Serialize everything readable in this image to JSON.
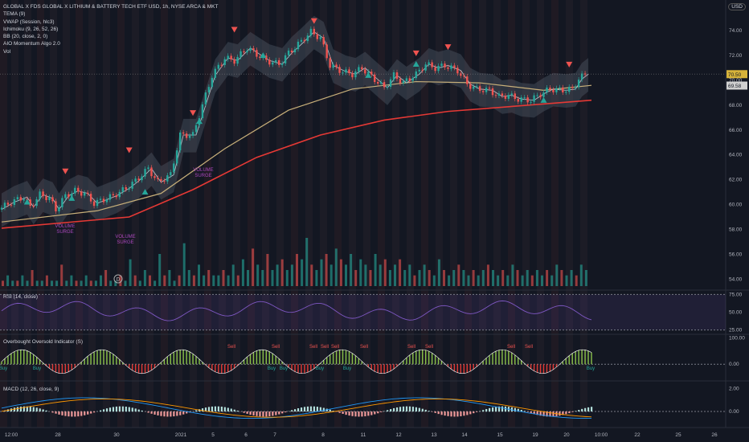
{
  "legend": {
    "symbol": "GLOBAL X FDS GLOBAL X LITHIUM & BATTERY TECH ETF USD, 1h, NYSE ARCA & MKT",
    "indicators": [
      "TEMA (9)",
      "VWAP (Session, hlc3)",
      "Ichimoku (9, 26, 52, 26)",
      "BB (20, close, 2, 0)",
      "AIO Momentum Algo 2.0",
      "Vol"
    ]
  },
  "currency": "USD",
  "panes": {
    "rsi": "RSI (14, close)",
    "obos": "Overbought Oversold Indicator (S)",
    "macd": "MACD (12, 26, close, 9)"
  },
  "signals": {
    "buy": "Buy",
    "sell": "Sell",
    "surge": [
      "VOLUME",
      "SURGE"
    ],
    "dividend": "D"
  },
  "price_badges": {
    "last": "70.50",
    "other": "69.58"
  },
  "colors": {
    "up": "#26a69a",
    "down": "#ef5350",
    "ema_red": "#e53935",
    "tan": "#c8b07a",
    "accent": "#d7b33a",
    "rsi": "#7e57c2",
    "buy": "#26a69a",
    "sell": "#ef5350"
  },
  "chart_data": [
    {
      "type": "candlestick",
      "title": "GLOBAL X FDS GLOBAL X LITHIUM & BATTERY TECH ETF USD, 1h, NYSE ARCA & MKT",
      "x_tick_labels": [
        "12:00",
        "28",
        "30",
        "2021",
        "5",
        "6",
        "7",
        "8",
        "11",
        "12",
        "13",
        "14",
        "15",
        "19",
        "20",
        "10:00",
        "22",
        "25",
        "26"
      ],
      "y_ticks": [
        "74.00",
        "72.00",
        "70.00",
        "68.00",
        "66.00",
        "64.00",
        "62.00",
        "60.00",
        "58.00",
        "56.00",
        "54.00"
      ],
      "ylim": [
        53.5,
        75.5
      ],
      "close_path": [
        [
          0,
          59.6
        ],
        [
          4,
          60.2
        ],
        [
          8,
          60.6
        ],
        [
          10,
          59.8
        ],
        [
          13,
          60.8
        ],
        [
          16,
          60.5
        ],
        [
          18,
          59.6
        ],
        [
          21,
          60.7
        ],
        [
          24,
          61.1
        ],
        [
          27,
          60.9
        ],
        [
          30,
          60.1
        ],
        [
          33,
          60.4
        ],
        [
          36,
          60.7
        ],
        [
          40,
          61.3
        ],
        [
          43,
          61.9
        ],
        [
          47,
          62.9
        ],
        [
          50,
          61.8
        ],
        [
          54,
          62.4
        ],
        [
          57,
          65.6
        ],
        [
          61,
          65.6
        ],
        [
          64,
          68.0
        ],
        [
          67,
          70.4
        ],
        [
          71,
          71.8
        ],
        [
          74,
          71.6
        ],
        [
          78,
          72.6
        ],
        [
          81,
          72.1
        ],
        [
          84,
          71.6
        ],
        [
          88,
          71.3
        ],
        [
          91,
          72.2
        ],
        [
          94,
          72.9
        ],
        [
          98,
          73.9
        ],
        [
          101,
          73.4
        ],
        [
          104,
          71.2
        ],
        [
          108,
          70.7
        ],
        [
          111,
          70.5
        ],
        [
          114,
          71.0
        ],
        [
          117,
          70.3
        ],
        [
          121,
          69.4
        ],
        [
          124,
          70.4
        ],
        [
          127,
          69.8
        ],
        [
          131,
          70.5
        ],
        [
          134,
          71.3
        ],
        [
          137,
          71.0
        ],
        [
          140,
          71.2
        ],
        [
          144,
          70.8
        ],
        [
          147,
          69.7
        ],
        [
          150,
          69.3
        ],
        [
          154,
          69.2
        ],
        [
          157,
          68.7
        ],
        [
          160,
          68.8
        ],
        [
          163,
          68.5
        ],
        [
          167,
          68.4
        ],
        [
          170,
          68.9
        ],
        [
          173,
          69.3
        ],
        [
          177,
          69.2
        ],
        [
          180,
          69.3
        ],
        [
          182,
          70.1
        ],
        [
          184,
          70.5
        ]
      ],
      "ema_red": [
        [
          0,
          58.1
        ],
        [
          40,
          59.0
        ],
        [
          60,
          61.2
        ],
        [
          80,
          63.8
        ],
        [
          100,
          65.6
        ],
        [
          120,
          66.8
        ],
        [
          140,
          67.5
        ],
        [
          160,
          67.9
        ],
        [
          185,
          68.4
        ]
      ],
      "ma_tan": [
        [
          0,
          58.6
        ],
        [
          30,
          59.5
        ],
        [
          50,
          60.9
        ],
        [
          70,
          64.5
        ],
        [
          90,
          67.6
        ],
        [
          110,
          69.3
        ],
        [
          130,
          69.9
        ],
        [
          150,
          69.8
        ],
        [
          170,
          69.2
        ],
        [
          185,
          69.6
        ]
      ],
      "volume": [
        1,
        2,
        1,
        1,
        2,
        1,
        3,
        1,
        1,
        2,
        1,
        1,
        4,
        1,
        2,
        1,
        1,
        2,
        1,
        1,
        2,
        3,
        1,
        1,
        2,
        1,
        5,
        2,
        1,
        3,
        2,
        1,
        6,
        2,
        3,
        1,
        2,
        8,
        3,
        2,
        4,
        2,
        3,
        2,
        2,
        3,
        2,
        4,
        2,
        5,
        3,
        7,
        4,
        3,
        6,
        3,
        4,
        5,
        3,
        4,
        6,
        5,
        9,
        4,
        3,
        5,
        6,
        4,
        7,
        5,
        4,
        6,
        3,
        5,
        4,
        3,
        6,
        4,
        5,
        3,
        4,
        5,
        3,
        4,
        2,
        3,
        4,
        3,
        2,
        5,
        3,
        2,
        3,
        4,
        3,
        2,
        3,
        2,
        3,
        4,
        3,
        2,
        3,
        2,
        4,
        3,
        2,
        3,
        2,
        3,
        2,
        3,
        2,
        4,
        3,
        2,
        3,
        2,
        4,
        3
      ]
    },
    {
      "type": "line",
      "title": "RSI (14, close)",
      "y_ticks": [
        "75.00",
        "50.00",
        "25.00"
      ],
      "ylim": [
        20,
        80
      ]
    },
    {
      "type": "bar",
      "title": "Overbought Oversold Indicator (S)",
      "y_ticks": [
        "100.00",
        "0.00"
      ],
      "ylim": [
        -60,
        110
      ]
    },
    {
      "type": "bar",
      "title": "MACD (12, 26, close, 9)",
      "y_ticks": [
        "2.00",
        "0.00"
      ],
      "ylim": [
        -1.4,
        2.6
      ]
    }
  ]
}
